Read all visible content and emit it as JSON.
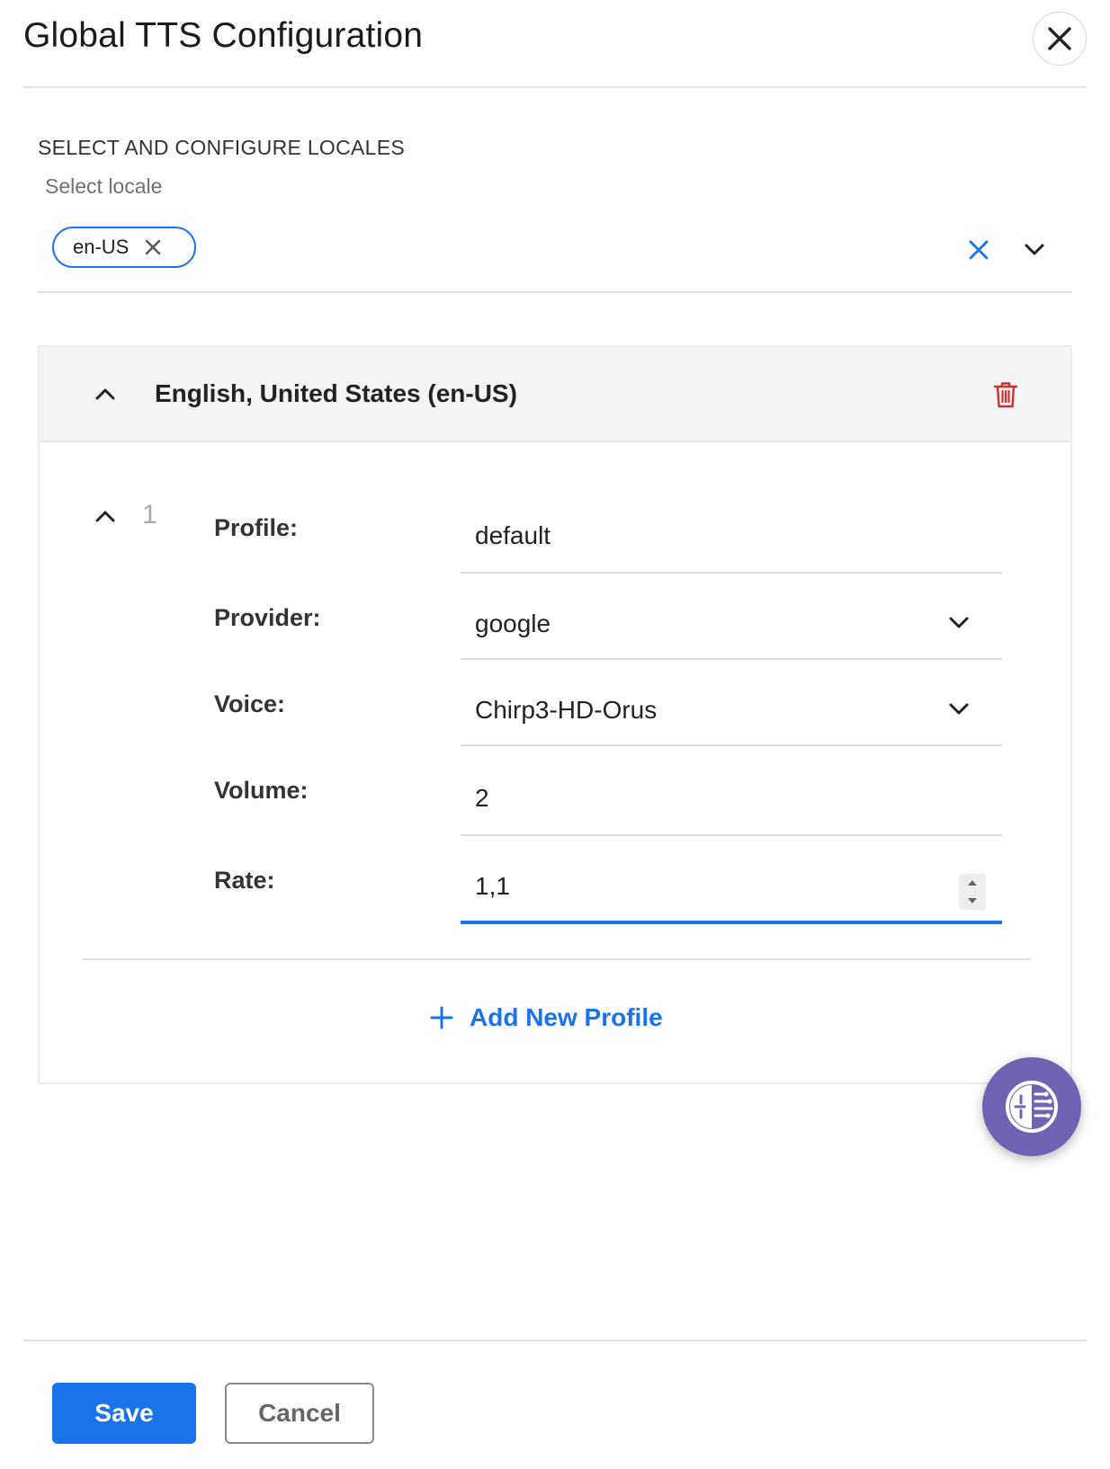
{
  "dialog": {
    "title": "Global TTS Configuration"
  },
  "locales": {
    "section_label": "SELECT AND CONFIGURE LOCALES",
    "select_label": "Select locale",
    "selected_chips": [
      "en-US"
    ]
  },
  "locale_panel": {
    "title": "English, United States (en-US)",
    "profile": {
      "number": "1",
      "fields": {
        "profile": {
          "label": "Profile:",
          "value": "default"
        },
        "provider": {
          "label": "Provider:",
          "value": "google"
        },
        "voice": {
          "label": "Voice:",
          "value": "Chirp3-HD-Orus"
        },
        "volume": {
          "label": "Volume:",
          "value": "2"
        },
        "rate": {
          "label": "Rate:",
          "value": "1,1"
        }
      }
    },
    "add_profile_label": "Add New Profile"
  },
  "footer": {
    "save_label": "Save",
    "cancel_label": "Cancel"
  },
  "colors": {
    "accent": "#1a73e8",
    "danger": "#d32f2f",
    "fab": "#6f64b3"
  }
}
